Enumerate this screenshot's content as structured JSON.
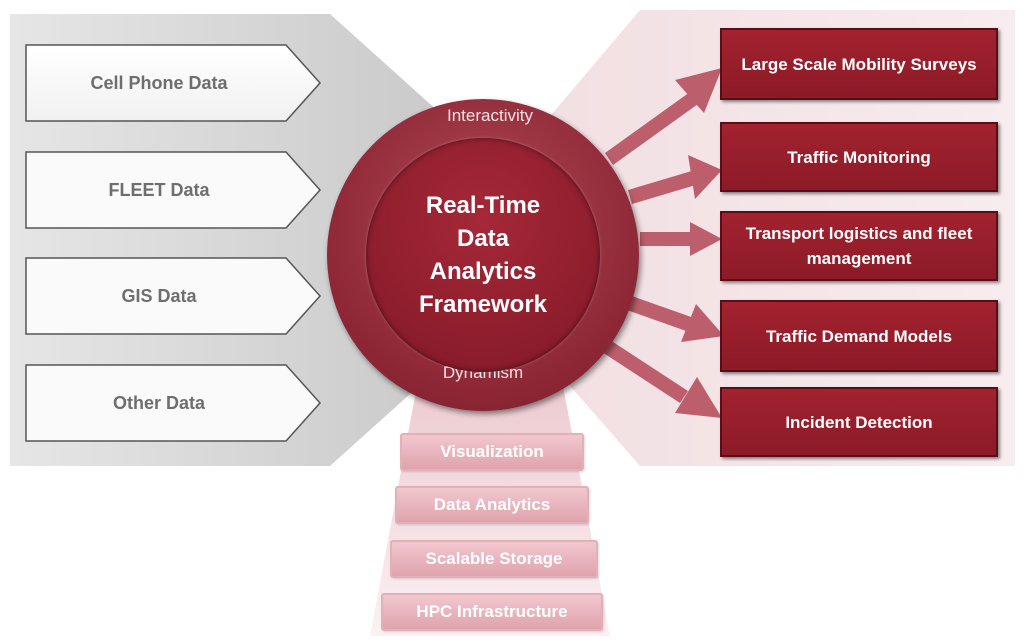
{
  "inputs": [
    {
      "label": "Cell Phone Data"
    },
    {
      "label": "FLEET Data"
    },
    {
      "label": "GIS Data"
    },
    {
      "label": "Other Data"
    }
  ],
  "center": {
    "title": "Real-Time\nData\nAnalytics\nFramework",
    "top_label": "Interactivity",
    "bottom_label": "Dynamism"
  },
  "outputs": [
    {
      "label": "Large Scale Mobility Surveys"
    },
    {
      "label": "Traffic Monitoring"
    },
    {
      "label": "Transport logistics and fleet management"
    },
    {
      "label": "Traffic Demand Models"
    },
    {
      "label": "Incident Detection"
    }
  ],
  "stack": [
    {
      "label": "Visualization"
    },
    {
      "label": "Data Analytics"
    },
    {
      "label": "Scalable Storage"
    },
    {
      "label": "HPC Infrastructure"
    }
  ],
  "colors": {
    "accent": "#8c1a27",
    "input_panel": "#d9d9d9",
    "output_panel": "#f3e2e4",
    "stack_box": "#e8b8c0"
  }
}
